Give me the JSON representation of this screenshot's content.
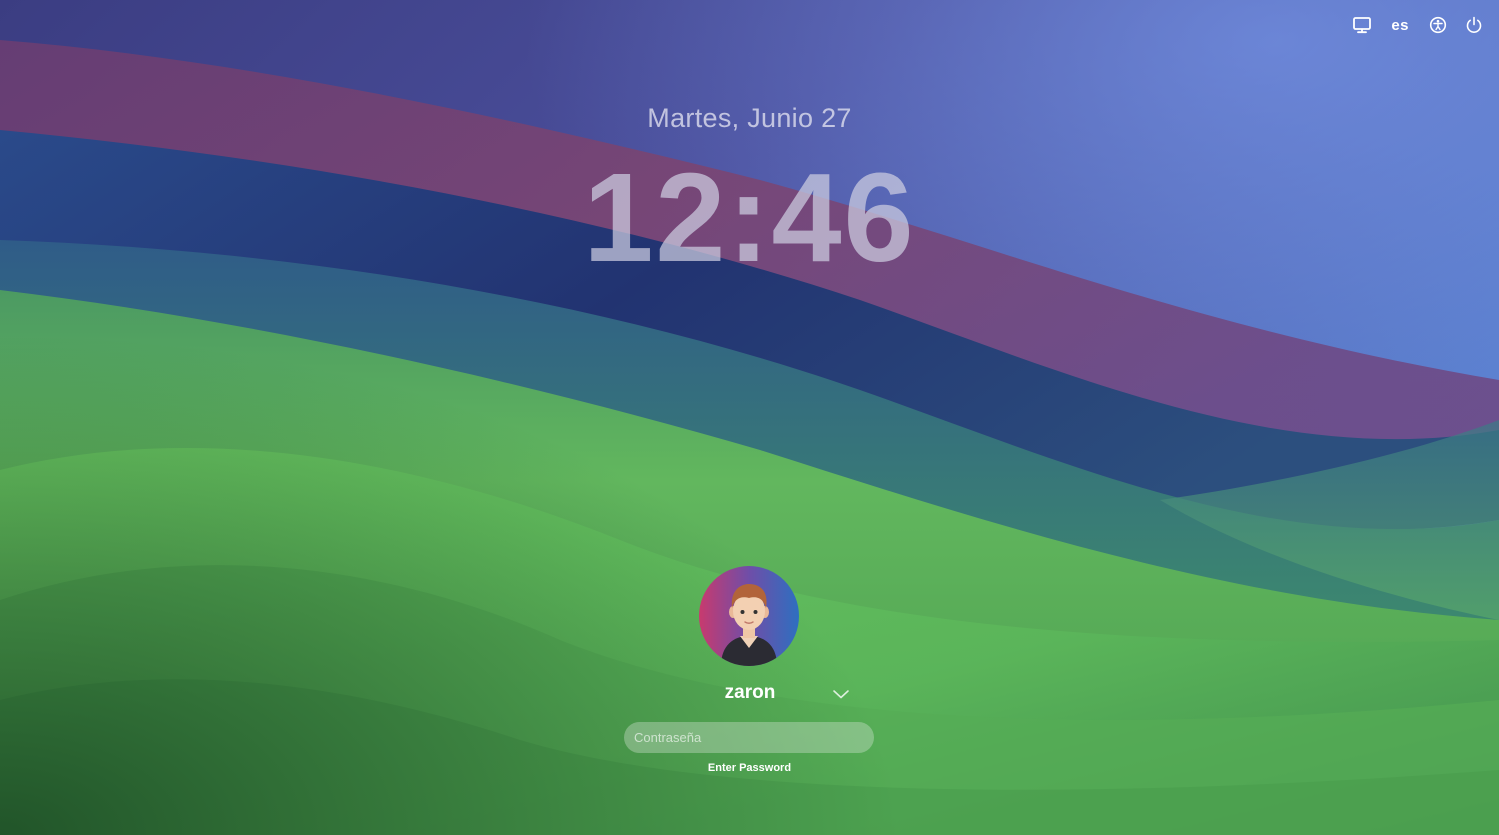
{
  "lock_screen": {
    "date": "Martes, Junio 27",
    "time": "12:46"
  },
  "status_bar": {
    "display_icon": "display-icon",
    "language": "es",
    "accessibility_icon": "accessibility-icon",
    "power_icon": "power-icon"
  },
  "login": {
    "user_name": "zaron",
    "avatar_icon": "user-avatar",
    "switch_icon": "chevron-down-icon",
    "password_placeholder": "Contraseña",
    "password_value": "",
    "hint": "Enter Password"
  },
  "colors": {
    "wallpaper_green": "#5cc25a",
    "wallpaper_blue": "#4f65c8",
    "wallpaper_magenta": "#7d4a7a",
    "wallpaper_navy": "#22336f"
  }
}
